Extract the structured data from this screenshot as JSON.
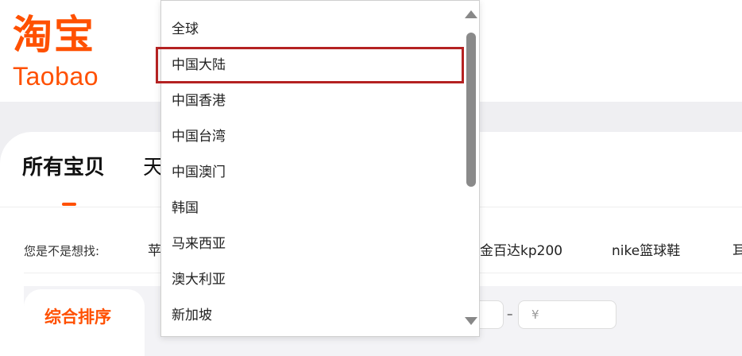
{
  "logo": {
    "chinese": "淘宝",
    "english": "Taobao"
  },
  "search_tabs": {
    "all_items": "所有宝贝",
    "tmall_partial": "天"
  },
  "suggestions": {
    "label": "您是不是想找:",
    "items": [
      "苹",
      "金百达kp200",
      "nike篮球鞋",
      "耳"
    ]
  },
  "sort": {
    "active_label": "综合排序"
  },
  "price_filter": {
    "dash": "–",
    "max_placeholder": "¥"
  },
  "region_dropdown": {
    "items": [
      "全球",
      "中国大陆",
      "中国香港",
      "中国台湾",
      "中国澳门",
      "韩国",
      "马来西亚",
      "澳大利亚",
      "新加坡"
    ],
    "selected": "中国大陆",
    "highlight_color": "#b42222",
    "scroll_up_icon": "triangle-up",
    "scroll_down_icon": "triangle-down"
  },
  "colors": {
    "brand": "#ff5000",
    "background_band": "#efeff2"
  }
}
